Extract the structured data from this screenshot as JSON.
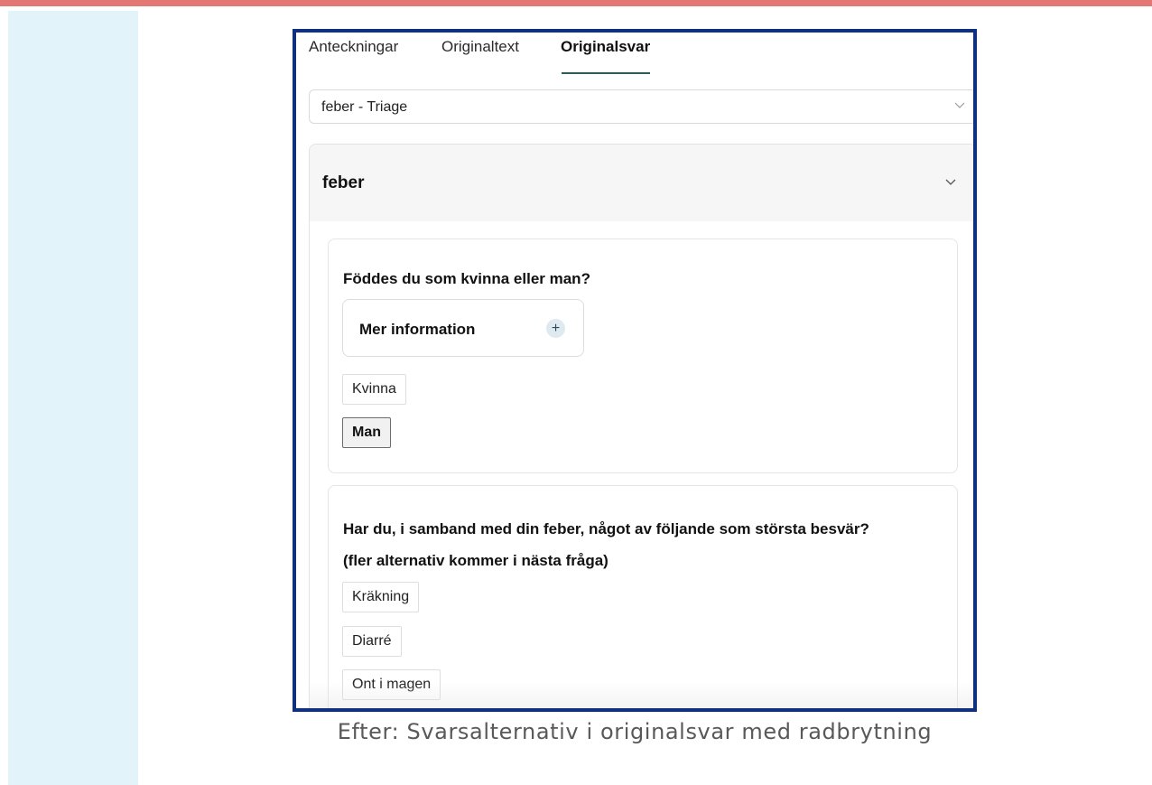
{
  "tabs": [
    {
      "label": "Anteckningar",
      "active": false
    },
    {
      "label": "Originaltext",
      "active": false
    },
    {
      "label": "Originalsvar",
      "active": true
    }
  ],
  "select": {
    "value": "feber - Triage",
    "icon": "chevron-down-icon"
  },
  "accordion": {
    "title": "feber",
    "expanded": true,
    "icon": "chevron-down-icon"
  },
  "questions": [
    {
      "text": "Föddes du som kvinna eller man?",
      "info_label": "Mer information",
      "info_icon": "plus-icon",
      "options": [
        {
          "label": "Kvinna",
          "selected": false
        },
        {
          "label": "Man",
          "selected": true
        }
      ]
    },
    {
      "text": "Har du, i samband med din feber, något av följande som största besvär?",
      "subtext": "(fler alternativ kommer i nästa fråga)",
      "options": [
        {
          "label": "Kräkning",
          "selected": false
        },
        {
          "label": "Diarré",
          "selected": false
        },
        {
          "label": "Ont i magen",
          "selected": false
        }
      ]
    }
  ],
  "caption": "Efter: Svarsalternativ i originalsvar med radbrytning",
  "colors": {
    "top_bar": "#e27774",
    "side_panel": "#e2f4f9",
    "frame_border": "#0f2f7f",
    "tab_underline": "#2f5b57"
  }
}
